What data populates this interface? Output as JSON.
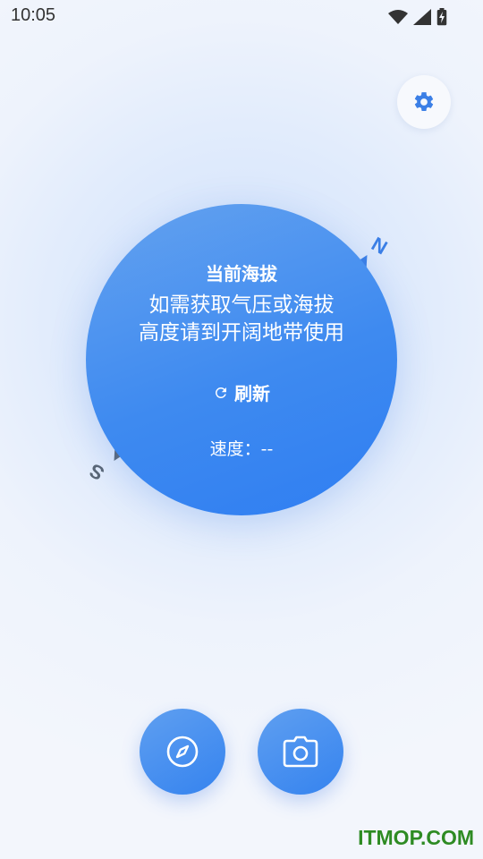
{
  "status_bar": {
    "time": "10:05",
    "icons": [
      "wifi-icon",
      "signal-icon",
      "battery-charging-icon"
    ]
  },
  "settings": {
    "icon": "gear-icon",
    "color": "#3b7fe6"
  },
  "compass": {
    "north_label": "N",
    "south_label": "S",
    "north_color": "#3b7fe6",
    "south_color": "#5a6675"
  },
  "altitude": {
    "title": "当前海拔",
    "message_line1": "如需获取气压或海拔",
    "message_line2": "高度请到开阔地带使用",
    "refresh_label": "刷新",
    "speed_text": "速度：--"
  },
  "actions": {
    "compass_icon": "compass-icon",
    "camera_icon": "camera-icon"
  },
  "watermark": "ITMOP.COM"
}
